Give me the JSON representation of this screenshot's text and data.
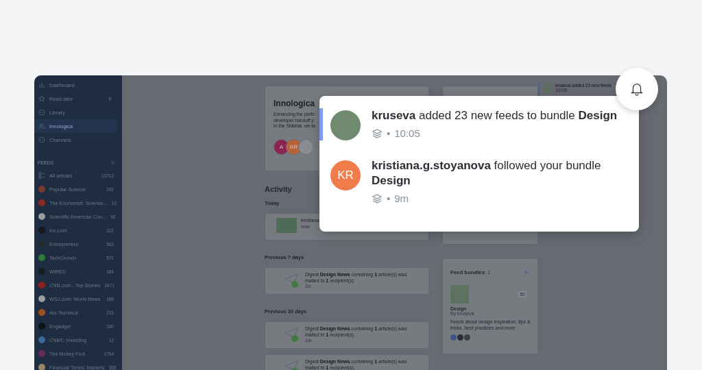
{
  "sidebar": {
    "nav": [
      {
        "label": "Dashboard",
        "kind": "chart",
        "selected": false
      },
      {
        "label": "Read later",
        "kind": "star",
        "count": "8",
        "selected": false
      },
      {
        "label": "Library",
        "kind": "chevron-circle",
        "selected": false
      },
      {
        "label": "Innologica",
        "kind": "people",
        "selected": true
      },
      {
        "label": "Channels",
        "kind": "chevron-circle",
        "selected": false
      }
    ],
    "feeds_heading": "FEEDS",
    "feeds": [
      {
        "label": "All articles",
        "count": "10712",
        "kind": "all"
      },
      {
        "label": "Popular Science",
        "count": "242",
        "kind": "feed",
        "color": "#7a3a30"
      },
      {
        "label": "The Economist: Science...",
        "count": "10",
        "kind": "feed",
        "color": "#8a2a2c"
      },
      {
        "label": "Scientific American Con...",
        "count": "92",
        "kind": "feed",
        "color": "#9a9c9f"
      },
      {
        "label": "Inc.com",
        "count": "222",
        "kind": "feed",
        "color": "#15181c"
      },
      {
        "label": "Entrepreneur",
        "count": "563",
        "kind": "feed",
        "color": "#25282c"
      },
      {
        "label": "TechCrunch",
        "count": "572",
        "kind": "feed",
        "color": "#2f7a3a"
      },
      {
        "label": "WIRED",
        "count": "184",
        "kind": "feed",
        "color": "#181b1f"
      },
      {
        "label": "CNN.com - Top Stories",
        "count": "3471",
        "kind": "feed",
        "color": "#8c2228"
      },
      {
        "label": "WSJ.com: World News",
        "count": "186",
        "kind": "feed",
        "color": "#9a9c9f"
      },
      {
        "label": "Ars Technica",
        "count": "215",
        "kind": "feed",
        "color": "#a0521e"
      },
      {
        "label": "Engadget",
        "count": "340",
        "kind": "feed",
        "color": "#101316"
      },
      {
        "label": "CNBC: Investing",
        "count": "12",
        "kind": "feed",
        "color": "#3a6a9a"
      },
      {
        "label": "The Motley Fool",
        "count": "1754",
        "kind": "feed",
        "color": "#6a2a5a"
      },
      {
        "label": "Financial Times: Markets",
        "count": "365",
        "kind": "feed",
        "color": "#9a8468"
      }
    ]
  },
  "team_card": {
    "title": "Innologica",
    "description": [
      "Enhancing the perfo",
      "developer handoff p",
      "In the Sidebar, we ta"
    ],
    "members": [
      {
        "kind": "initials",
        "initials": "A",
        "color": "#8a2450"
      },
      {
        "kind": "initials",
        "initials": "KR",
        "color": "#b8623a"
      },
      {
        "kind": "photo"
      }
    ]
  },
  "activity": {
    "title": "Activity",
    "groups": [
      {
        "heading": "Today",
        "items": [
          {
            "kind": "follow",
            "text": "kristiana.",
            "time": "now"
          }
        ]
      },
      {
        "heading": "Previous 7 days",
        "items": [
          {
            "kind": "digest",
            "text": "Digest **Design News** containing **1** article(s) was mailed to **1** recipient(s).",
            "time": "2d"
          }
        ]
      },
      {
        "heading": "Previous 30 days",
        "items": [
          {
            "kind": "digest",
            "text": "Digest **Design News** containing **1** article(s) was mailed to **1** recipient(s).",
            "time": "1w"
          },
          {
            "kind": "digest",
            "text": "Digest **Design News** containing **1** article(s) was mailed to **1** recipient(s)."
          }
        ]
      }
    ]
  },
  "feed_bundles": {
    "title": "Feed bundles",
    "count": "1",
    "bundles": [
      {
        "name": "Design",
        "author": "By kruseva",
        "badge": "50",
        "description": "Feeds about design inspiration, tips & tricks, best practices and more"
      }
    ]
  },
  "notification_preview": {
    "text": "kruseva added 23 new feeds",
    "time": "10:05"
  },
  "notifications": [
    {
      "kind": "photo",
      "text": "**kruseva** added 23 new feeds to bundle **Design**",
      "separator": "•",
      "time": "10:05",
      "unread": true
    },
    {
      "kind": "initials",
      "initials": "KR",
      "color": "#f07c4b",
      "text": "**kristiana.g.stoyanova** followed your bundle **Design**",
      "separator": "•",
      "time": "9m",
      "unread": false
    }
  ]
}
